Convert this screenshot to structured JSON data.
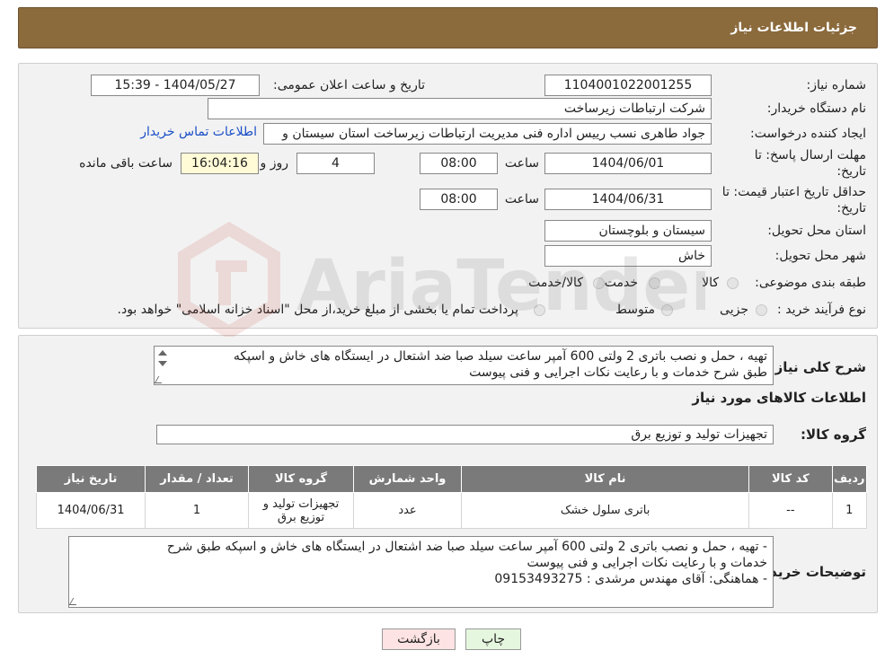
{
  "header": {
    "title": "جزئیات اطلاعات نیاز"
  },
  "form": {
    "need_number_label": "شماره نیاز:",
    "need_number": "1104001022001255",
    "announce_label": "تاریخ و ساعت اعلان عمومی:",
    "announce_value": "1404/05/27 - 15:39",
    "buyer_label": "نام دستگاه خریدار:",
    "buyer_value": "شرکت ارتباطات زیرساخت",
    "creator_label": "ایجاد کننده درخواست:",
    "creator_value": "جواد طاهری نسب رییس اداره فنی مدیریت ارتباطات زیرساخت استان سیستان و",
    "contact_link": "اطلاعات تماس خریدار",
    "deadline_label_1": "مهلت ارسال پاسخ: تا",
    "deadline_label_2": "تاریخ:",
    "deadline_date": "1404/06/01",
    "time_label": "ساعت",
    "deadline_time": "08:00",
    "days_value": "4",
    "days_label": "روز و",
    "remaining_time": "16:04:16",
    "remaining_label": "ساعت باقی مانده",
    "validity_label_1": "حداقل تاریخ اعتبار قیمت: تا",
    "validity_label_2": "تاریخ:",
    "validity_date": "1404/06/31",
    "validity_time": "08:00",
    "province_label": "استان محل تحویل:",
    "province_value": "سیستان و بلوچستان",
    "city_label": "شهر محل تحویل:",
    "city_value": "خاش",
    "category_label": "طبقه بندی موضوعی:",
    "category_options": [
      "کالا",
      "خدمت",
      "کالا/خدمت"
    ],
    "process_label": "نوع فرآیند خرید :",
    "process_options": [
      "جزیی",
      "متوسط"
    ],
    "process_note": "پرداخت تمام یا بخشی از مبلغ خرید،از محل \"اسناد خزانه اسلامی\" خواهد بود."
  },
  "details": {
    "summary_label": "شرح کلی نیاز:",
    "summary_line1": "تهیه ، حمل و نصب باتری 2 ولتی  600 آمپر ساعت سیلد صبا ضد اشتعال در ایستگاه های خاش و اسپکه",
    "summary_line2": "طبق شرح خدمات و با رعایت نکات اجرایی و فنی پیوست",
    "goods_info_title": "اطلاعات کالاهای مورد نیاز",
    "goods_group_label": "گروه کالا:",
    "goods_group_value": "تجهیزات تولید و توزیع برق",
    "table": {
      "headers": [
        "ردیف",
        "کد کالا",
        "نام کالا",
        "واحد شمارش",
        "گروه کالا",
        "تعداد / مقدار",
        "تاریخ نیاز"
      ],
      "rows": [
        [
          "1",
          "--",
          "باتری سلول خشک",
          "عدد",
          "تجهیزات تولید و توزیع برق",
          "1",
          "1404/06/31"
        ]
      ]
    },
    "buyer_notes_label": "توضیحات خریدار:",
    "buyer_notes_line1": "- تهیه ، حمل و نصب باتری 2 ولتی  600 آمپر ساعت سیلد صبا ضد اشتعال در ایستگاه های خاش و اسپکه طبق شرح",
    "buyer_notes_line2": "خدمات و با رعایت نکات اجرایی و فنی پیوست",
    "buyer_notes_line3": "- هماهنگی: آقای مهندس مرشدی : 09153493275"
  },
  "buttons": {
    "print": "چاپ",
    "back": "بازگشت"
  },
  "watermark": "AriaTender.net",
  "colors": {
    "header_bg": "#8b6a3c",
    "table_header_bg": "#7a7a7a",
    "link": "#1a4fc7"
  }
}
